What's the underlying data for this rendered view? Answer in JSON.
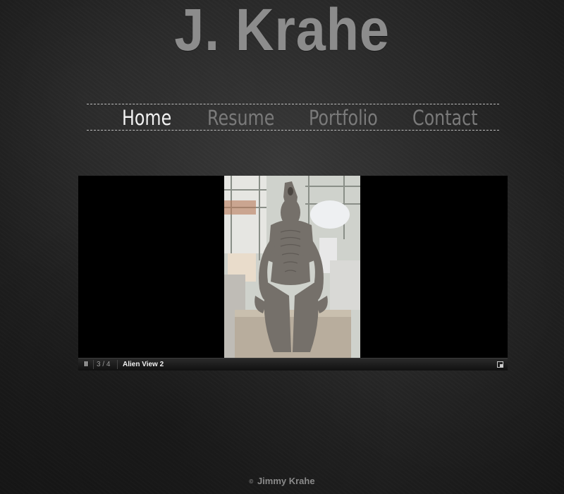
{
  "site": {
    "title": "J. Krahe"
  },
  "nav": {
    "items": [
      {
        "label": "Home",
        "active": true
      },
      {
        "label": "Resume",
        "active": false
      },
      {
        "label": "Portfolio",
        "active": false
      },
      {
        "label": "Contact",
        "active": false
      }
    ]
  },
  "slideshow": {
    "counter": "3 / 4",
    "caption": "Alien View 2",
    "pause_symbol": "II",
    "image_subject": "clay alien sculpture"
  },
  "footer": {
    "copyright_symbol": "©",
    "text": "Jimmy Krahe"
  }
}
